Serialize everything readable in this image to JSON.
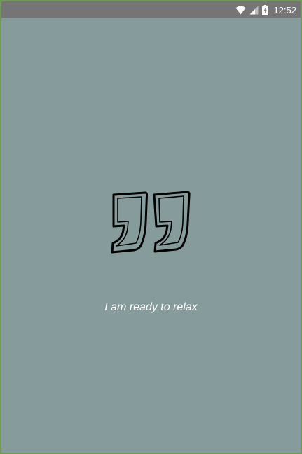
{
  "status_bar": {
    "time": "12:52",
    "icons": [
      "wifi-icon",
      "signal-icon",
      "battery-icon"
    ]
  },
  "main": {
    "icon": "quote-icon",
    "tagline": "I am ready to relax"
  },
  "colors": {
    "background": "#869c9c",
    "status_bar": "#757575",
    "text": "#ffffff",
    "icon_stroke": "#000000"
  }
}
